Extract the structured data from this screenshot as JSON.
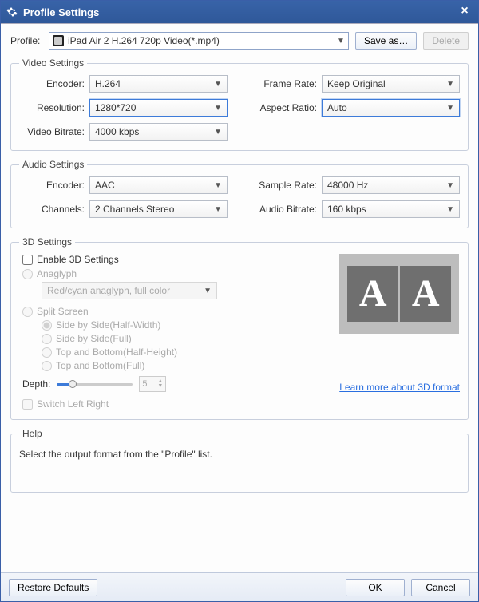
{
  "title": "Profile Settings",
  "profile": {
    "label": "Profile:",
    "value": "iPad Air 2 H.264 720p Video(*.mp4)",
    "saveAs": "Save as…",
    "delete": "Delete"
  },
  "video": {
    "legend": "Video Settings",
    "encoderLabel": "Encoder:",
    "encoder": "H.264",
    "resolutionLabel": "Resolution:",
    "resolution": "1280*720",
    "bitrateLabel": "Video Bitrate:",
    "bitrate": "4000 kbps",
    "frameRateLabel": "Frame Rate:",
    "frameRate": "Keep Original",
    "aspectLabel": "Aspect Ratio:",
    "aspect": "Auto"
  },
  "audio": {
    "legend": "Audio Settings",
    "encoderLabel": "Encoder:",
    "encoder": "AAC",
    "channelsLabel": "Channels:",
    "channels": "2 Channels Stereo",
    "sampleRateLabel": "Sample Rate:",
    "sampleRate": "48000 Hz",
    "bitrateLabel": "Audio Bitrate:",
    "bitrate": "160 kbps"
  },
  "threeD": {
    "legend": "3D Settings",
    "enable": "Enable 3D Settings",
    "anaglyph": "Anaglyph",
    "anaglyphMode": "Red/cyan anaglyph, full color",
    "split": "Split Screen",
    "splitOptions": {
      "sbshw": "Side by Side(Half-Width)",
      "sbsfull": "Side by Side(Full)",
      "tbhh": "Top and Bottom(Half-Height)",
      "tbfull": "Top and Bottom(Full)"
    },
    "depthLabel": "Depth:",
    "depthValue": "5",
    "switchLR": "Switch Left Right",
    "learnMore": "Learn more about 3D format"
  },
  "help": {
    "legend": "Help",
    "text": "Select the output format from the \"Profile\" list."
  },
  "footer": {
    "restore": "Restore Defaults",
    "ok": "OK",
    "cancel": "Cancel"
  }
}
